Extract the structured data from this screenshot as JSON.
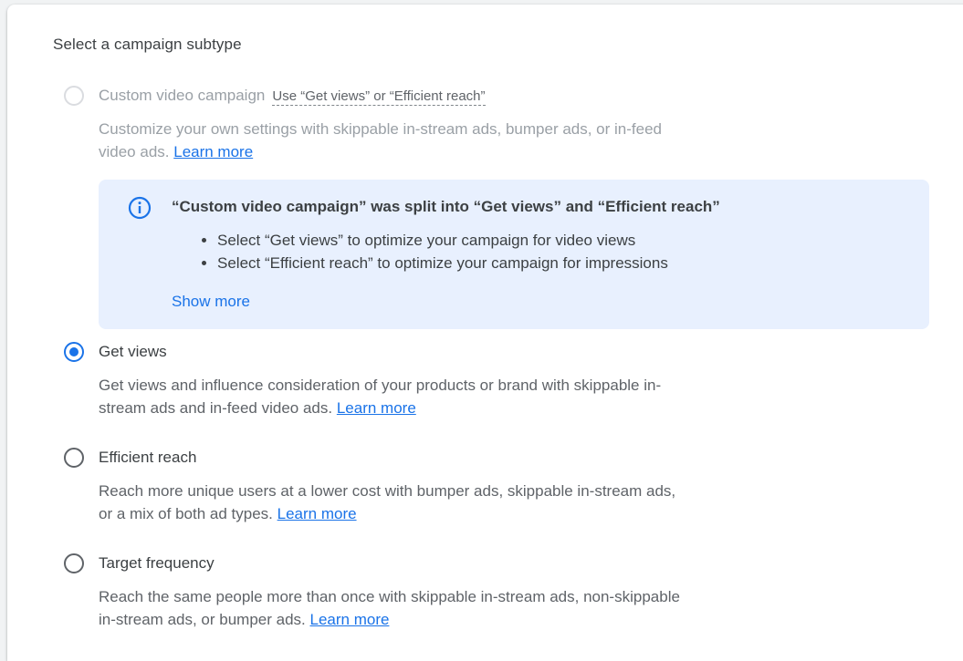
{
  "section": {
    "title": "Select a campaign subtype"
  },
  "options": [
    {
      "label": "Custom video campaign",
      "hint": "Use “Get views” or “Efficient reach”",
      "description": "Customize your own settings with skippable in-stream ads, bumper ads, or in-feed video ads.",
      "learn_more": "Learn more",
      "state": "disabled"
    },
    {
      "label": "Get views",
      "description": "Get views and influence consideration of your products or brand with skippable in-stream ads and in-feed video ads.",
      "learn_more": "Learn more",
      "state": "selected"
    },
    {
      "label": "Efficient reach",
      "description": "Reach more unique users at a lower cost with bumper ads, skippable in-stream ads, or a mix of both ad types.",
      "learn_more": "Learn more",
      "state": "unselected"
    },
    {
      "label": "Target frequency",
      "description": "Reach the same people more than once with skippable in-stream ads, non-skippable in-stream ads, or bumper ads.",
      "learn_more": "Learn more",
      "state": "unselected"
    }
  ],
  "info_box": {
    "icon": "info-icon",
    "title": "“Custom video campaign” was split into “Get views” and “Efficient reach”",
    "bullets": [
      "Select “Get views” to optimize your campaign for video views",
      "Select “Efficient reach” to optimize your campaign for impressions"
    ],
    "show_more": "Show more"
  },
  "colors": {
    "accent": "#1a73e8",
    "info_background": "#e8f0fe",
    "text": "#3c4043",
    "secondary_text": "#5f6368",
    "disabled_text": "#9aa0a6"
  }
}
